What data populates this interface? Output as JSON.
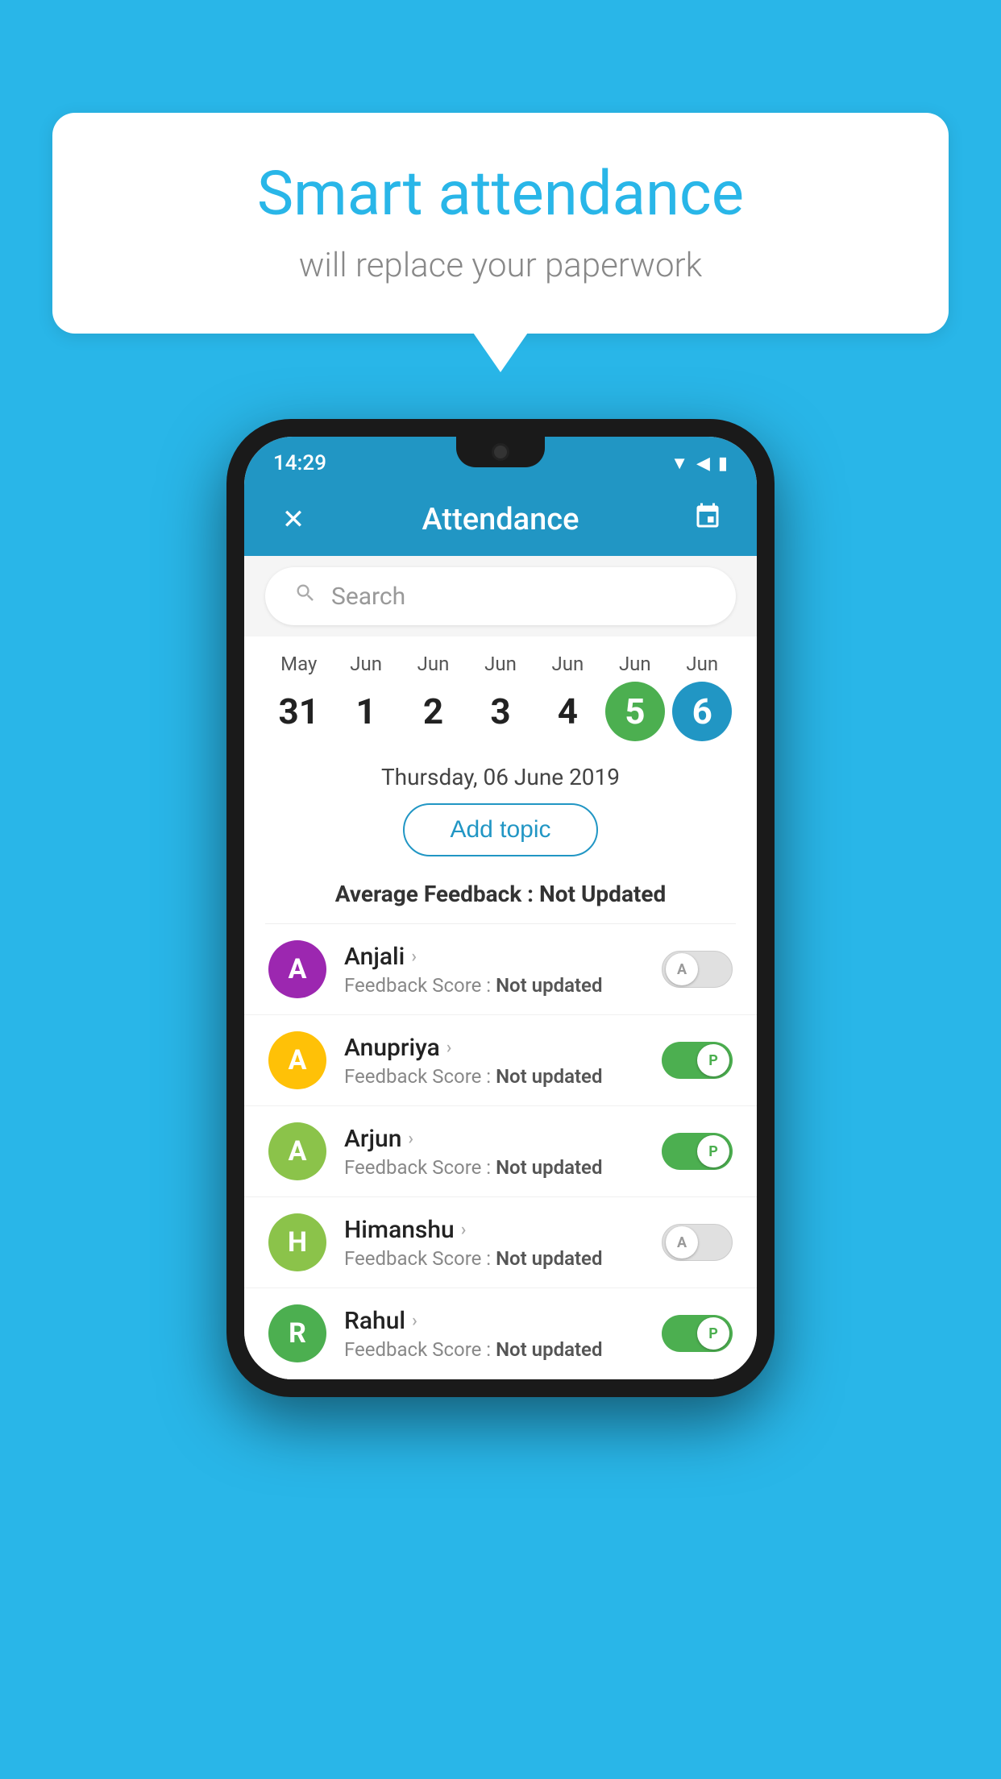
{
  "background_color": "#29b6e8",
  "speech_bubble": {
    "title": "Smart attendance",
    "subtitle": "will replace your paperwork"
  },
  "status_bar": {
    "time": "14:29",
    "icons": [
      "wifi",
      "signal",
      "battery"
    ]
  },
  "app_bar": {
    "close_label": "✕",
    "title": "Attendance",
    "calendar_icon": "📅"
  },
  "search": {
    "placeholder": "Search"
  },
  "calendar": {
    "days": [
      {
        "month": "May",
        "date": "31",
        "state": "normal"
      },
      {
        "month": "Jun",
        "date": "1",
        "state": "normal"
      },
      {
        "month": "Jun",
        "date": "2",
        "state": "normal"
      },
      {
        "month": "Jun",
        "date": "3",
        "state": "normal"
      },
      {
        "month": "Jun",
        "date": "4",
        "state": "normal"
      },
      {
        "month": "Jun",
        "date": "5",
        "state": "today"
      },
      {
        "month": "Jun",
        "date": "6",
        "state": "selected"
      }
    ]
  },
  "date_label": "Thursday, 06 June 2019",
  "add_topic_label": "Add topic",
  "average_feedback_label": "Average Feedback :",
  "average_feedback_value": "Not Updated",
  "students": [
    {
      "name": "Anjali",
      "avatar_letter": "A",
      "avatar_color": "#9c27b0",
      "feedback_label": "Feedback Score :",
      "feedback_value": "Not updated",
      "attendance": "absent"
    },
    {
      "name": "Anupriya",
      "avatar_letter": "A",
      "avatar_color": "#ffc107",
      "feedback_label": "Feedback Score :",
      "feedback_value": "Not updated",
      "attendance": "present"
    },
    {
      "name": "Arjun",
      "avatar_letter": "A",
      "avatar_color": "#8bc34a",
      "feedback_label": "Feedback Score :",
      "feedback_value": "Not updated",
      "attendance": "present"
    },
    {
      "name": "Himanshu",
      "avatar_letter": "H",
      "avatar_color": "#8bc34a",
      "feedback_label": "Feedback Score :",
      "feedback_value": "Not updated",
      "attendance": "absent"
    },
    {
      "name": "Rahul",
      "avatar_letter": "R",
      "avatar_color": "#4caf50",
      "feedback_label": "Feedback Score :",
      "feedback_value": "Not updated",
      "attendance": "present"
    }
  ]
}
